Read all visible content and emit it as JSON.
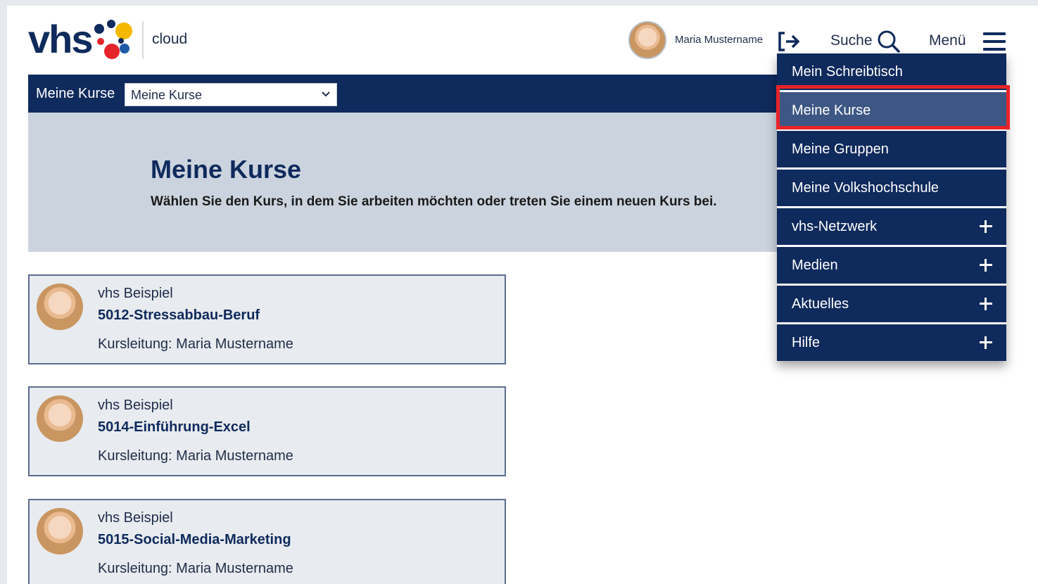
{
  "header": {
    "logo_text": "vhs",
    "logo_subtitle": "cloud",
    "user_name": "Maria Mustername",
    "search_label": "Suche",
    "menu_label": "Menü"
  },
  "navbar": {
    "label": "Meine Kurse",
    "select_value": "Meine Kurse"
  },
  "banner": {
    "title": "Meine Kurse",
    "subtitle": "Wählen Sie den Kurs, in dem Sie arbeiten möchten oder treten Sie einem neuen Kurs bei."
  },
  "courses": [
    {
      "school": "vhs Beispiel",
      "title": "5012-Stressabbau-Beruf",
      "lead": "Kursleitung: Maria Mustername"
    },
    {
      "school": "vhs Beispiel",
      "title": "5014-Einführung-Excel",
      "lead": "Kursleitung: Maria Mustername"
    },
    {
      "school": "vhs Beispiel",
      "title": "5015-Social-Media-Marketing",
      "lead": "Kursleitung: Maria Mustername"
    }
  ],
  "menu": {
    "items": [
      {
        "label": "Mein Schreibtisch",
        "expandable": false,
        "active": false
      },
      {
        "label": "Meine Kurse",
        "expandable": false,
        "active": true
      },
      {
        "label": "Meine Gruppen",
        "expandable": false,
        "active": false
      },
      {
        "label": "Meine Volkshochschule",
        "expandable": false,
        "active": false
      },
      {
        "label": "vhs-Netzwerk",
        "expandable": true,
        "active": false
      },
      {
        "label": "Medien",
        "expandable": true,
        "active": false
      },
      {
        "label": "Aktuelles",
        "expandable": true,
        "active": false
      },
      {
        "label": "Hilfe",
        "expandable": true,
        "active": false
      }
    ]
  },
  "colors": {
    "brand_navy": "#0f2a5c",
    "active_item": "#3d5784",
    "banner_bg": "#cbd3de",
    "highlight": "#e8242a",
    "logo_dot_yellow": "#f5b800",
    "logo_dot_red": "#e4262c",
    "logo_dot_blue": "#1f5aa8"
  },
  "icons": [
    "logout-icon",
    "search-icon",
    "hamburger-icon",
    "chevron-down-icon",
    "plus-icon"
  ]
}
